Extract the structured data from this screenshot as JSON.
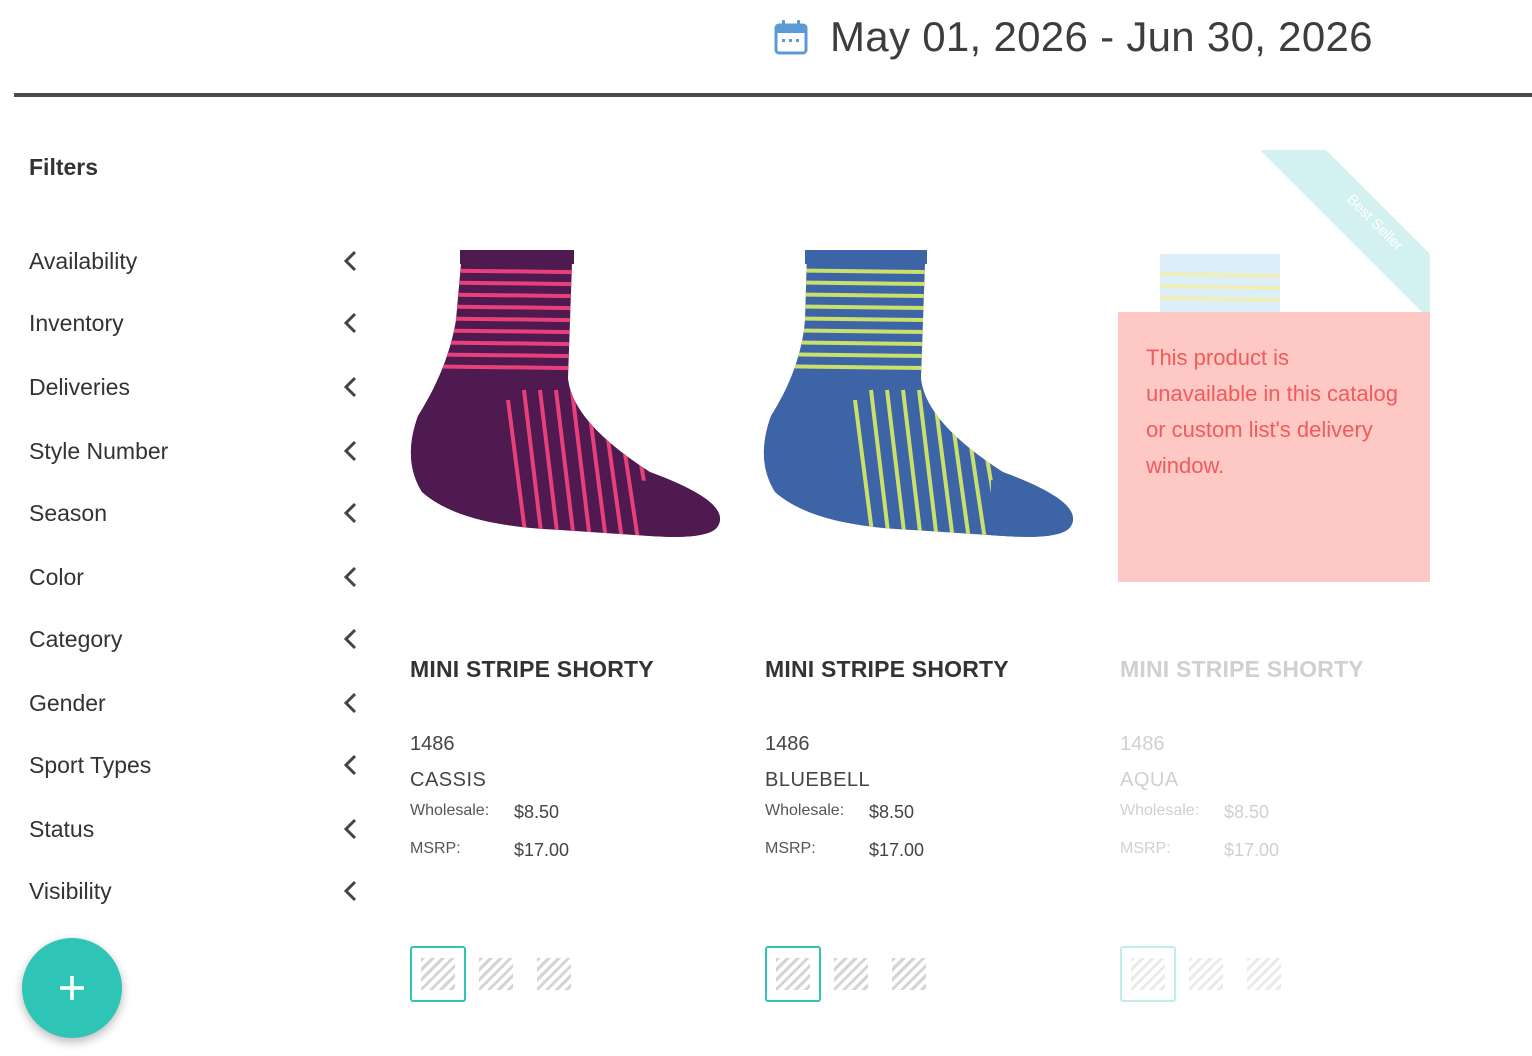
{
  "header": {
    "date_range": "May 01, 2026 - Jun 30, 2026",
    "calendar_icon": "calendar-icon"
  },
  "sidebar": {
    "title": "Filters",
    "items": [
      {
        "label": "Availability"
      },
      {
        "label": "Inventory"
      },
      {
        "label": "Deliveries"
      },
      {
        "label": "Style Number"
      },
      {
        "label": "Season"
      },
      {
        "label": "Color"
      },
      {
        "label": "Category"
      },
      {
        "label": "Gender"
      },
      {
        "label": "Sport Types"
      },
      {
        "label": "Status"
      },
      {
        "label": "Visibility"
      }
    ],
    "add_button_icon": "plus-icon"
  },
  "products": [
    {
      "name": "MINI STRIPE SHORTY",
      "style_number": "1486",
      "color": "CASSIS",
      "wholesale_label": "Wholesale:",
      "wholesale": "$8.50",
      "msrp_label": "MSRP:",
      "msrp": "$17.00",
      "sock_color": "#4e1a4f",
      "stripe_color": "#e8407a"
    },
    {
      "name": "MINI STRIPE SHORTY",
      "style_number": "1486",
      "color": "BLUEBELL",
      "wholesale_label": "Wholesale:",
      "wholesale": "$8.50",
      "msrp_label": "MSRP:",
      "msrp": "$17.00",
      "sock_color": "#3e64a8",
      "stripe_color": "#c9e06a"
    },
    {
      "name": "MINI STRIPE SHORTY",
      "style_number": "1486",
      "color": "AQUA",
      "wholesale_label": "Wholesale:",
      "wholesale": "$8.50",
      "msrp_label": "MSRP:",
      "msrp": "$17.00",
      "badge": "Best Seller",
      "unavailable_message": "This product is unavailable in this catalog or custom list's delivery window."
    }
  ],
  "colors": {
    "accent": "#2ec4b6",
    "warning_bg": "#fec8c5",
    "warning_text": "#f05b5b",
    "badge_bg": "#d4f1f1"
  }
}
